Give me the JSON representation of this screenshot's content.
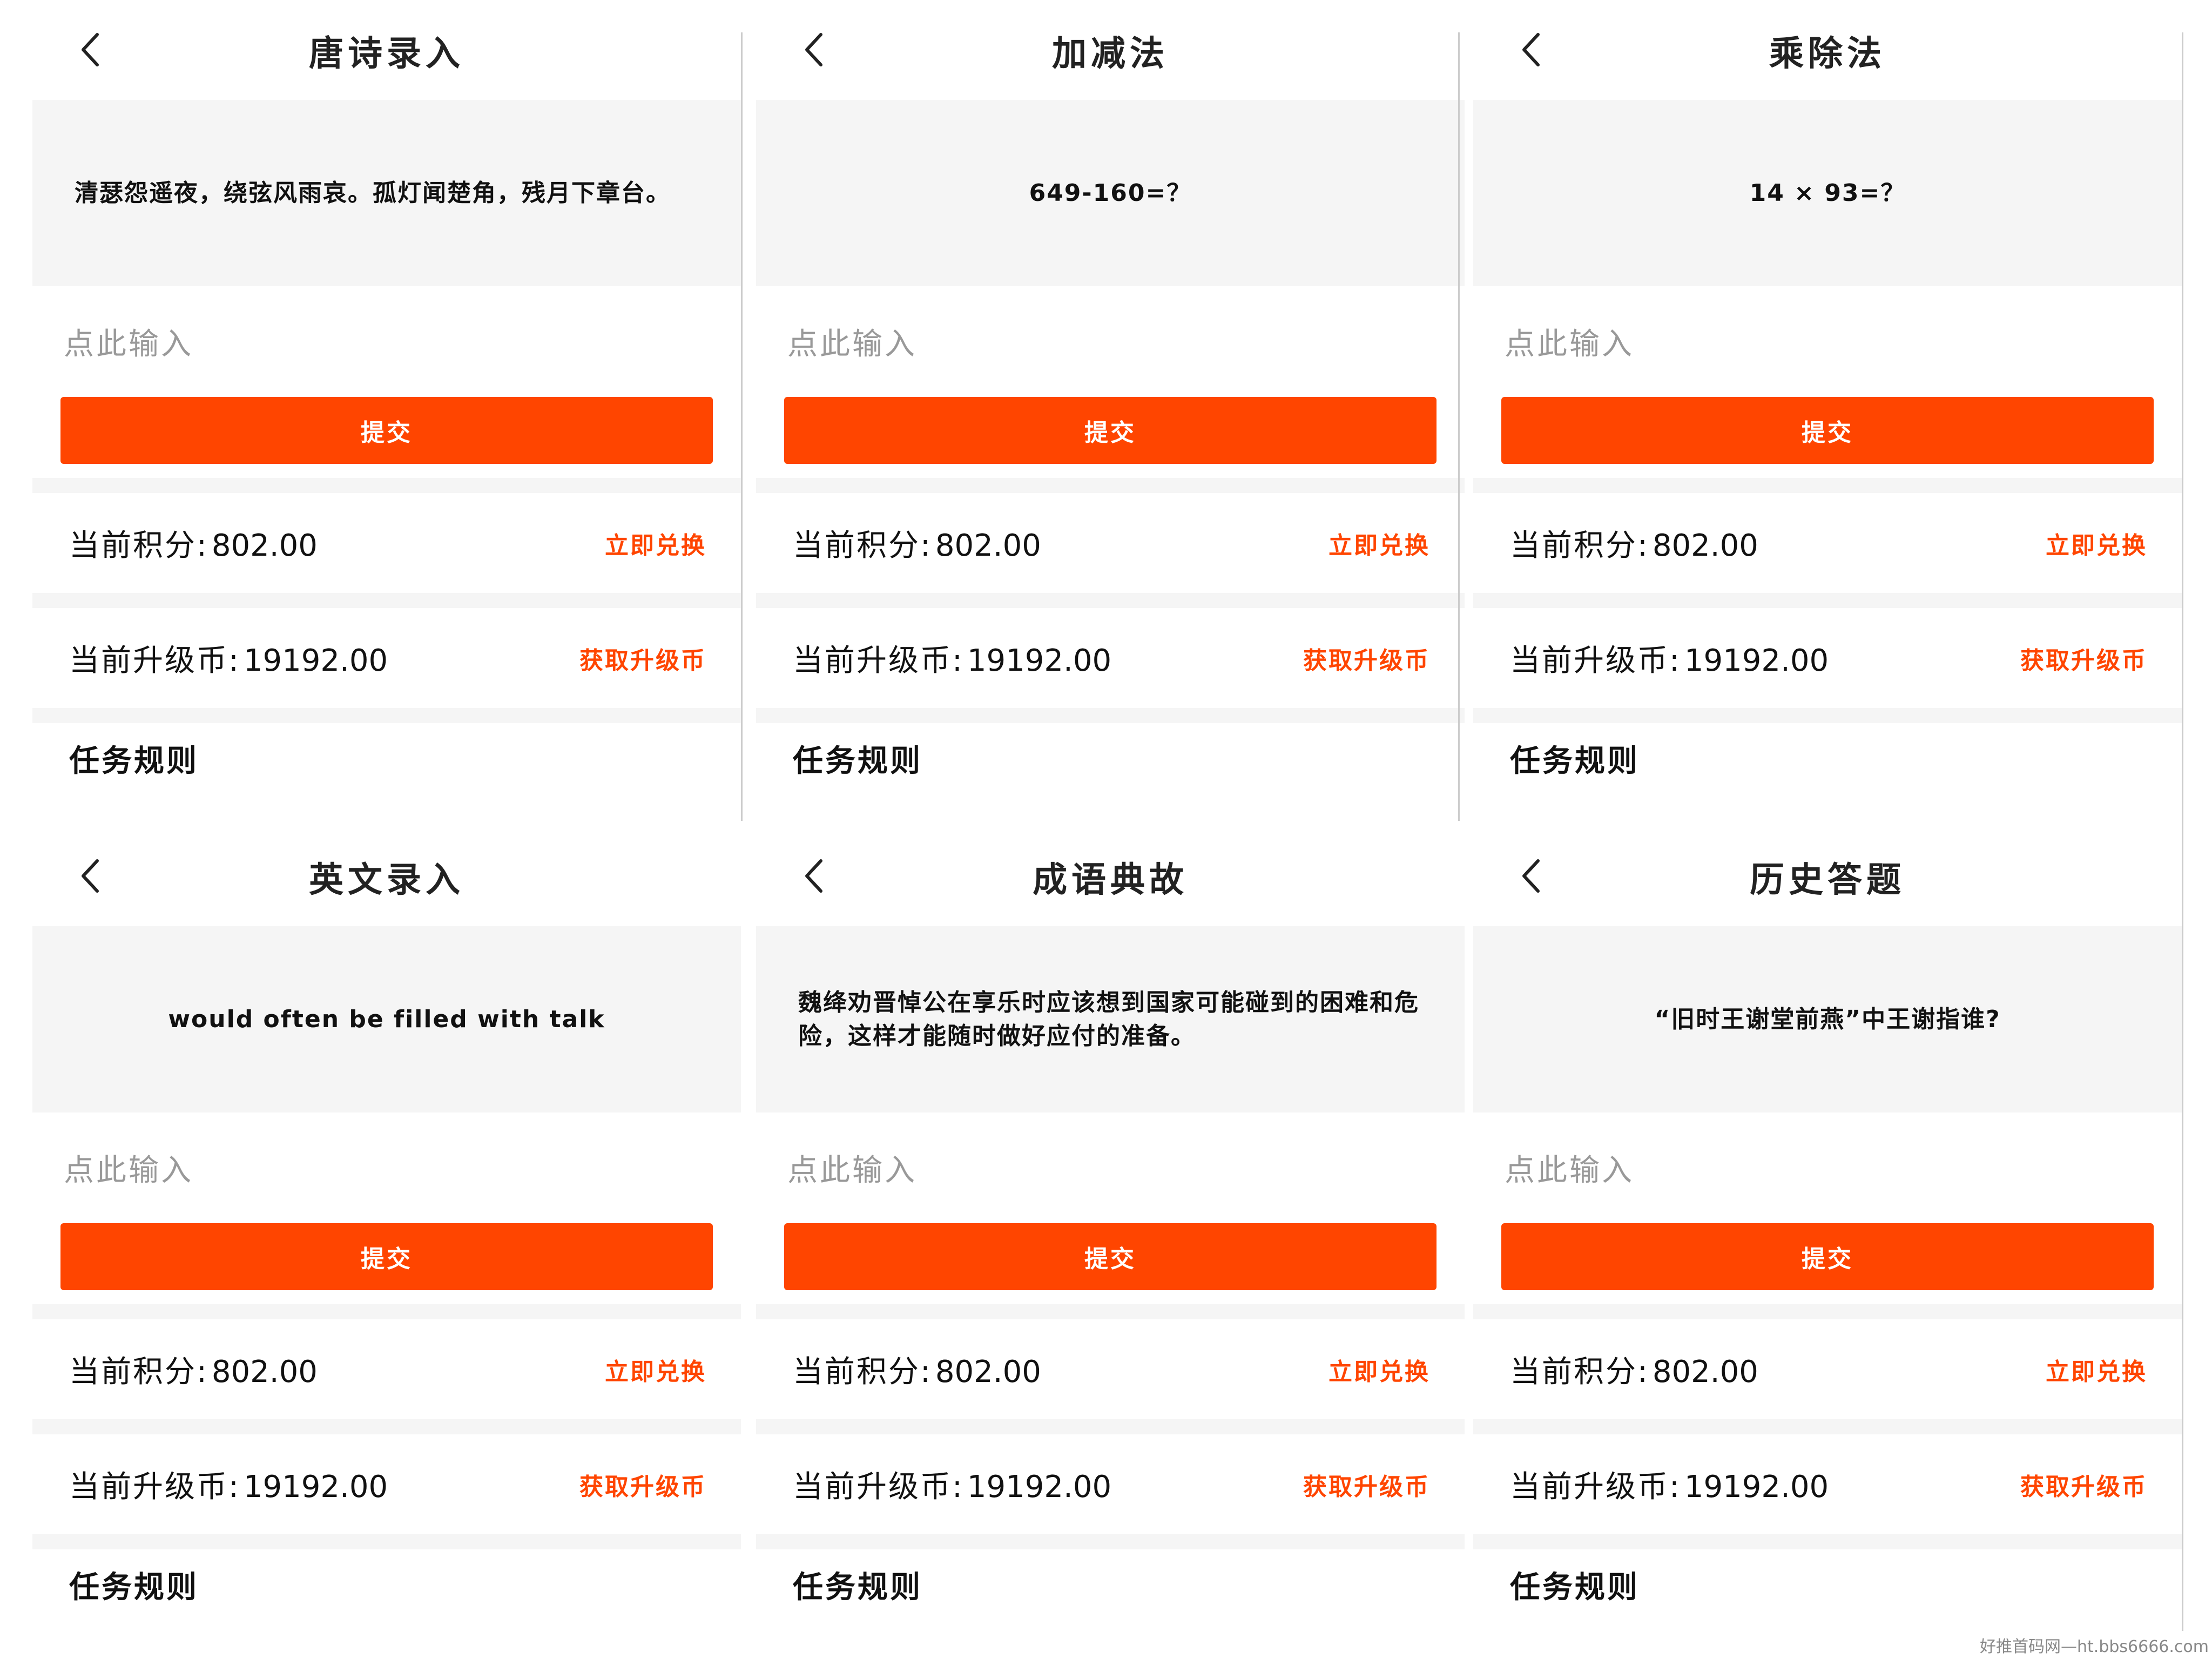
{
  "panels": [
    {
      "title": "唐诗录入",
      "question": "清瑟怨遥夜，绕弦风雨哀。孤灯闻楚角，残月下章台。",
      "input_placeholder": "点此输入",
      "submit_label": "提交",
      "points_label": "当前积分:",
      "points_value": "802.00",
      "redeem_link": "立即兑换",
      "coins_label": "当前升级币:",
      "coins_value": "19192.00",
      "get_coins_link": "获取升级币",
      "rules_label": "任务规则"
    },
    {
      "title": "加减法",
      "question": "649-160=？",
      "input_placeholder": "点此输入",
      "submit_label": "提交",
      "points_label": "当前积分:",
      "points_value": "802.00",
      "redeem_link": "立即兑换",
      "coins_label": "当前升级币:",
      "coins_value": "19192.00",
      "get_coins_link": "获取升级币",
      "rules_label": "任务规则"
    },
    {
      "title": "乘除法",
      "question": "14 × 93=？",
      "input_placeholder": "点此输入",
      "submit_label": "提交",
      "points_label": "当前积分:",
      "points_value": "802.00",
      "redeem_link": "立即兑换",
      "coins_label": "当前升级币:",
      "coins_value": "19192.00",
      "get_coins_link": "获取升级币",
      "rules_label": "任务规则"
    },
    {
      "title": "英文录入",
      "question": "would often be filled with talk",
      "input_placeholder": "点此输入",
      "submit_label": "提交",
      "points_label": "当前积分:",
      "points_value": "802.00",
      "redeem_link": "立即兑换",
      "coins_label": "当前升级币:",
      "coins_value": "19192.00",
      "get_coins_link": "获取升级币",
      "rules_label": "任务规则"
    },
    {
      "title": "成语典故",
      "question": "魏绛劝晋悼公在享乐时应该想到国家可能碰到的困难和危险，这样才能随时做好应付的准备。",
      "input_placeholder": "点此输入",
      "submit_label": "提交",
      "points_label": "当前积分:",
      "points_value": "802.00",
      "redeem_link": "立即兑换",
      "coins_label": "当前升级币:",
      "coins_value": "19192.00",
      "get_coins_link": "获取升级币",
      "rules_label": "任务规则"
    },
    {
      "title": "历史答题",
      "question": "“旧时王谢堂前燕”中王谢指谁?",
      "input_placeholder": "点此输入",
      "submit_label": "提交",
      "points_label": "当前积分:",
      "points_value": "802.00",
      "redeem_link": "立即兑换",
      "coins_label": "当前升级币:",
      "coins_value": "19192.00",
      "get_coins_link": "获取升级币",
      "rules_label": "任务规则"
    }
  ],
  "icons": {
    "back": "chevron-left-icon"
  },
  "colors": {
    "accent": "#ff4500",
    "question_bg": "#f5f5f5",
    "placeholder": "#999999"
  },
  "watermark": "好推首码网—ht.bbs6666.com"
}
